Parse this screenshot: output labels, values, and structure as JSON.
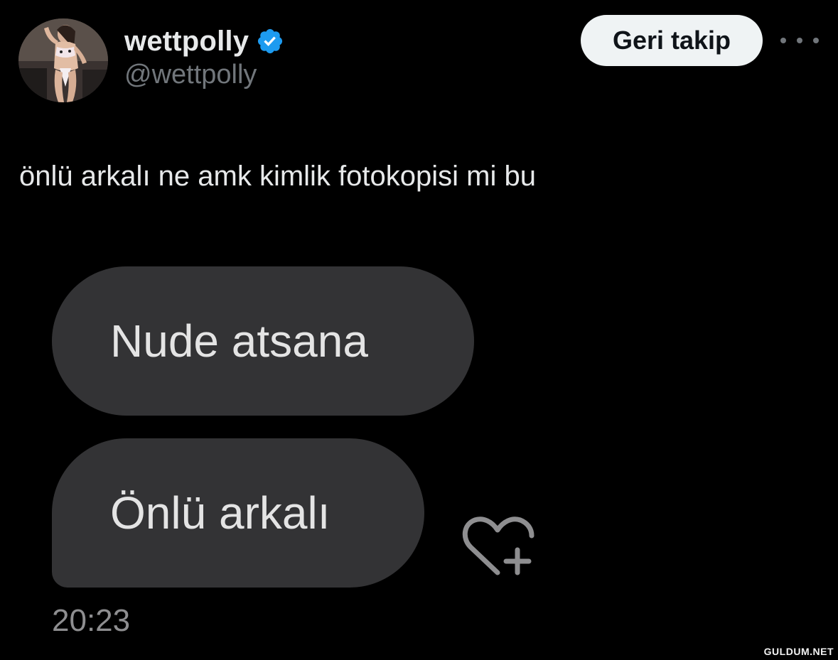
{
  "tweet": {
    "author": {
      "display_name": "wettpolly",
      "handle": "@wettpolly",
      "verified": true,
      "verified_color": "#1d9bf0"
    },
    "follow_button_label": "Geri takip",
    "more_icon": "more-horizontal-icon",
    "text": "önlü arkalı ne amk kimlik fotokopisi mi bu"
  },
  "chat_screenshot": {
    "messages": [
      {
        "text": "Nude atsana"
      },
      {
        "text": "Önlü arkalı"
      }
    ],
    "time": "20:23",
    "reaction_icon": "heart-plus-icon",
    "bubble_color": "#333335"
  },
  "watermark": "GULDUM.NET"
}
